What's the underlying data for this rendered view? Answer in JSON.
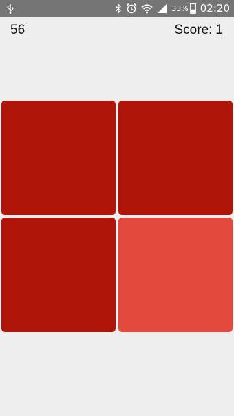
{
  "status_bar": {
    "left_icon": "usb-icon",
    "icons": [
      "bluetooth-icon",
      "alarm-icon",
      "wifi-icon",
      "signal-icon",
      "battery-icon"
    ],
    "battery_percent": "33%",
    "time": "02:20"
  },
  "game": {
    "timer": "56",
    "score_label": "Score:",
    "score_value": "1",
    "tiles": [
      {
        "color": "#b0150c",
        "odd": false
      },
      {
        "color": "#b0150c",
        "odd": false
      },
      {
        "color": "#b0150c",
        "odd": false
      },
      {
        "color": "#e3493f",
        "odd": true
      }
    ]
  },
  "colors": {
    "background": "#eeeeee",
    "status_bar": "#757575",
    "tile_base": "#b0150c",
    "tile_odd": "#e3493f",
    "text": "#111111"
  }
}
